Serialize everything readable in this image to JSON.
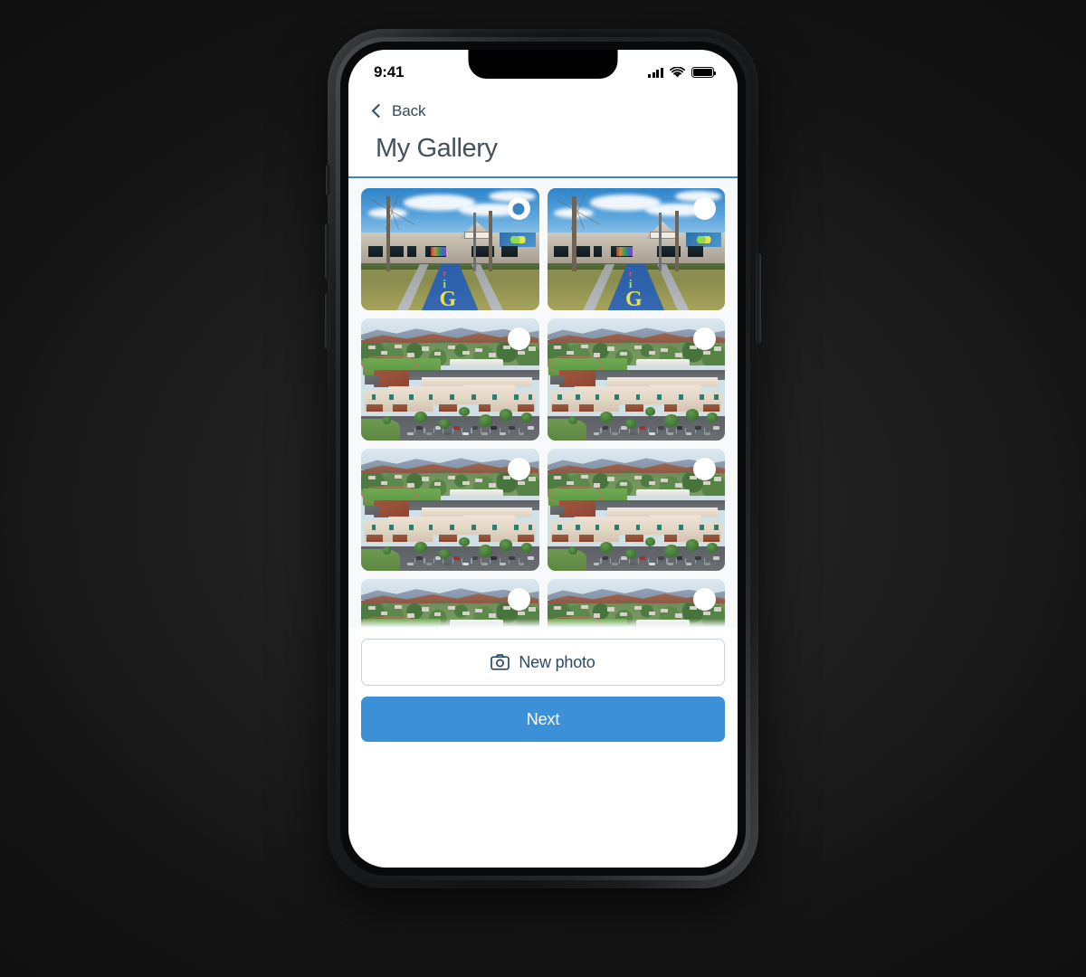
{
  "status_bar": {
    "time": "9:41",
    "cellular_icon": "cellular-signal-icon",
    "wifi_icon": "wifi-icon",
    "battery_icon": "battery-full-icon"
  },
  "header": {
    "back_label": "Back",
    "back_icon": "chevron-left-icon",
    "title": "My Gallery",
    "rule_color": "#3c82c4"
  },
  "gallery": {
    "background_color": "#f7f9fb",
    "selected_index": 0,
    "photos": [
      {
        "id": 1,
        "alt": "School entrance with painted walkway",
        "art": "a",
        "selected": true
      },
      {
        "id": 2,
        "alt": "School entrance with painted walkway",
        "art": "a",
        "selected": false
      },
      {
        "id": 3,
        "alt": "Aerial view of school campus",
        "art": "b",
        "selected": false
      },
      {
        "id": 4,
        "alt": "Aerial view of school campus",
        "art": "b",
        "selected": false
      },
      {
        "id": 5,
        "alt": "Aerial view of school campus",
        "art": "b",
        "selected": false
      },
      {
        "id": 6,
        "alt": "Aerial view of school campus",
        "art": "b",
        "selected": false
      },
      {
        "id": 7,
        "alt": "Aerial view of school campus",
        "art": "b",
        "selected": false
      },
      {
        "id": 8,
        "alt": "Aerial view of school campus",
        "art": "b",
        "selected": false
      },
      {
        "id": 9,
        "alt": "Aerial view of school campus",
        "art": "b",
        "selected": false
      },
      {
        "id": 10,
        "alt": "Aerial view of school campus",
        "art": "b",
        "selected": false
      }
    ]
  },
  "footer": {
    "new_photo_label": "New photo",
    "new_photo_icon": "camera-icon",
    "next_label": "Next",
    "next_color": "#3c90d8"
  },
  "device": {
    "frame": "iphone-x-frame",
    "buttons": [
      "mute-switch",
      "volume-up",
      "volume-down",
      "power"
    ]
  }
}
